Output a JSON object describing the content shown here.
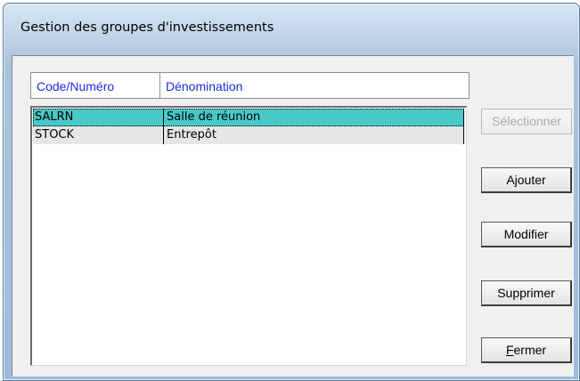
{
  "window": {
    "title": "Gestion des groupes d'investissements"
  },
  "list": {
    "columns": [
      "Code/Numéro",
      "Dénomination"
    ],
    "rows": [
      {
        "code": "SALRN",
        "name": "Salle de réunion",
        "selected": true
      },
      {
        "code": "STOCK",
        "name": "Entrepôt",
        "selected": false
      }
    ]
  },
  "buttons": {
    "select": {
      "label": "Sélectionner",
      "enabled": false
    },
    "add": {
      "label": "Ajouter",
      "enabled": true
    },
    "modify": {
      "label": "Modifier",
      "enabled": true
    },
    "delete": {
      "label": "Supprimer",
      "enabled": true
    },
    "close": {
      "mnemonic": "F",
      "rest": "ermer",
      "enabled": true
    }
  },
  "colors": {
    "header_text": "#1a2ee0",
    "selection": "#49c8c8"
  }
}
